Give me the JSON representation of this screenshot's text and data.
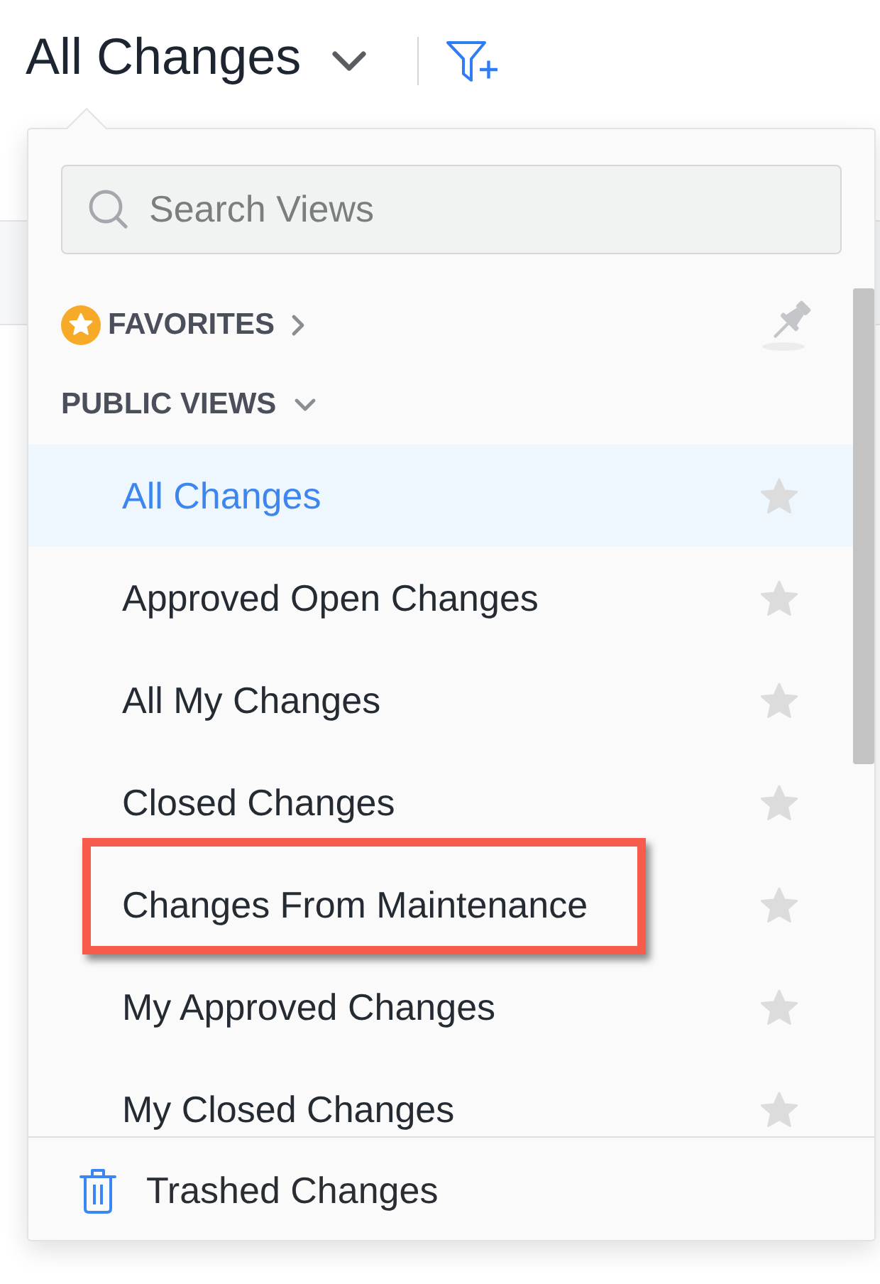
{
  "header": {
    "title": "All Changes"
  },
  "search": {
    "placeholder": "Search Views"
  },
  "sections": [
    {
      "kind": "favorites",
      "label": "FAVORITES",
      "expanded": false
    },
    {
      "kind": "public",
      "label": "PUBLIC VIEWS",
      "expanded": true,
      "views": [
        {
          "label": "All Changes",
          "selected": true,
          "favorite": false,
          "highlighted": false
        },
        {
          "label": "Approved Open Changes",
          "selected": false,
          "favorite": false,
          "highlighted": false
        },
        {
          "label": "All My Changes",
          "selected": false,
          "favorite": false,
          "highlighted": false
        },
        {
          "label": "Closed Changes",
          "selected": false,
          "favorite": false,
          "highlighted": false
        },
        {
          "label": "Changes From Maintenance",
          "selected": false,
          "favorite": false,
          "highlighted": true
        },
        {
          "label": "My Approved Changes",
          "selected": false,
          "favorite": false,
          "highlighted": false
        },
        {
          "label": "My Closed Changes",
          "selected": false,
          "favorite": false,
          "highlighted": false
        }
      ]
    }
  ],
  "footer": {
    "label": "Trashed Changes"
  }
}
